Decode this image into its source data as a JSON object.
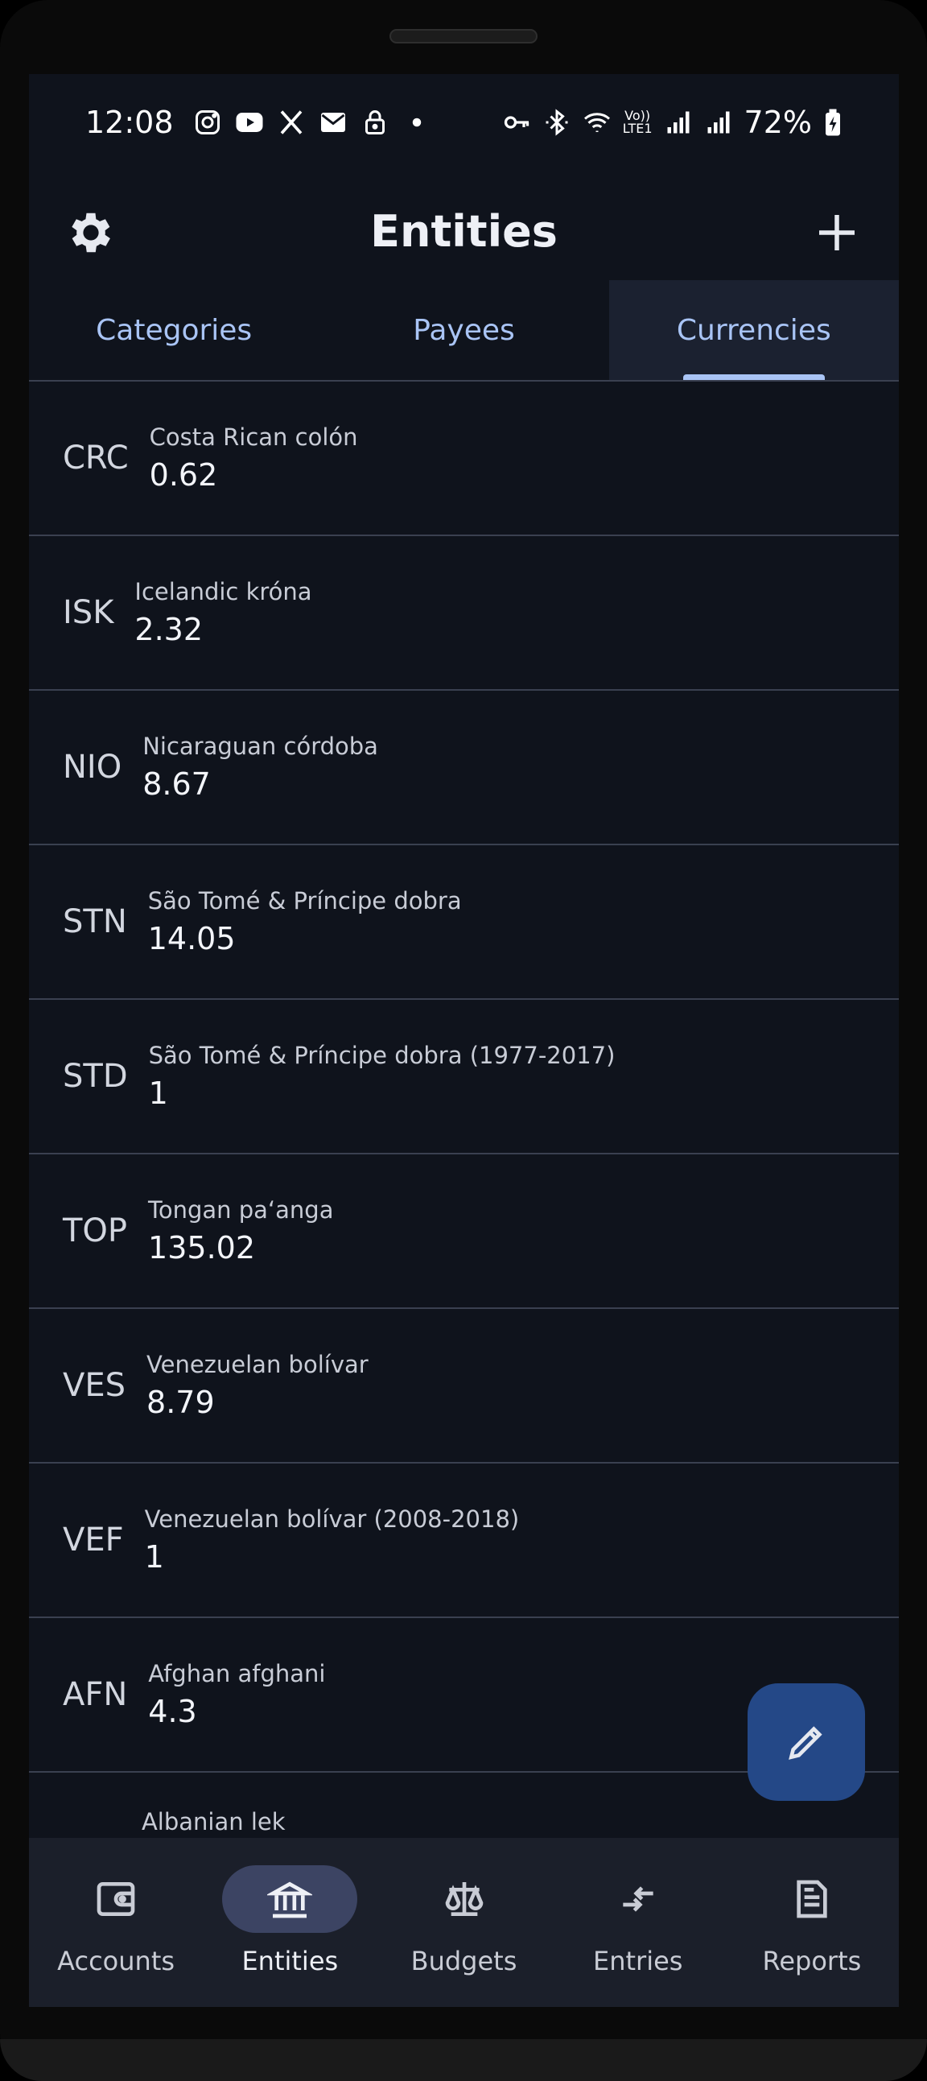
{
  "status_bar": {
    "time": "12:08",
    "battery": "72%",
    "left_icons": [
      "instagram-icon",
      "youtube-icon",
      "x-icon",
      "mail-icon",
      "lock-icon",
      "dot-icon"
    ],
    "right_icons": [
      "key-icon",
      "bluetooth-icon",
      "wifi-icon",
      "volte-icon",
      "signal-icon",
      "signal-icon",
      "battery-icon"
    ],
    "network_label_top": "Vo))",
    "network_label_bottom": "LTE1"
  },
  "header": {
    "title": "Entities",
    "settings_icon": "gear-icon",
    "add_icon": "plus-icon"
  },
  "tabs": [
    {
      "label": "Categories",
      "active": false
    },
    {
      "label": "Payees",
      "active": false
    },
    {
      "label": "Currencies",
      "active": true
    }
  ],
  "currencies": [
    {
      "code": "CRC",
      "name": "Costa Rican colón",
      "value": "0.62"
    },
    {
      "code": "ISK",
      "name": "Icelandic króna",
      "value": "2.32"
    },
    {
      "code": "NIO",
      "name": "Nicaraguan córdoba",
      "value": "8.67"
    },
    {
      "code": "STN",
      "name": "São Tomé & Príncipe dobra",
      "value": "14.05"
    },
    {
      "code": "STD",
      "name": "São Tomé & Príncipe dobra (1977-2017)",
      "value": "1"
    },
    {
      "code": "TOP",
      "name": "Tongan paʻanga",
      "value": "135.02"
    },
    {
      "code": "VES",
      "name": "Venezuelan bolívar",
      "value": "8.79"
    },
    {
      "code": "VEF",
      "name": "Venezuelan bolívar (2008-2018)",
      "value": "1"
    },
    {
      "code": "AFN",
      "name": "Afghan afghani",
      "value": "4.3"
    }
  ],
  "partial_row": {
    "name": "Albanian lek"
  },
  "fab": {
    "icon": "pencil-icon"
  },
  "bottom_nav": [
    {
      "label": "Accounts",
      "icon": "wallet-icon",
      "active": false
    },
    {
      "label": "Entities",
      "icon": "bank-icon",
      "active": true
    },
    {
      "label": "Budgets",
      "icon": "scale-icon",
      "active": false
    },
    {
      "label": "Entries",
      "icon": "transfer-icon",
      "active": false
    },
    {
      "label": "Reports",
      "icon": "report-icon",
      "active": false
    }
  ],
  "colors": {
    "background": "#0f131c",
    "accent": "#a9c4f5",
    "fab": "#244887",
    "nav_background": "#1b1f2a",
    "nav_active_pill": "#3c4463"
  }
}
